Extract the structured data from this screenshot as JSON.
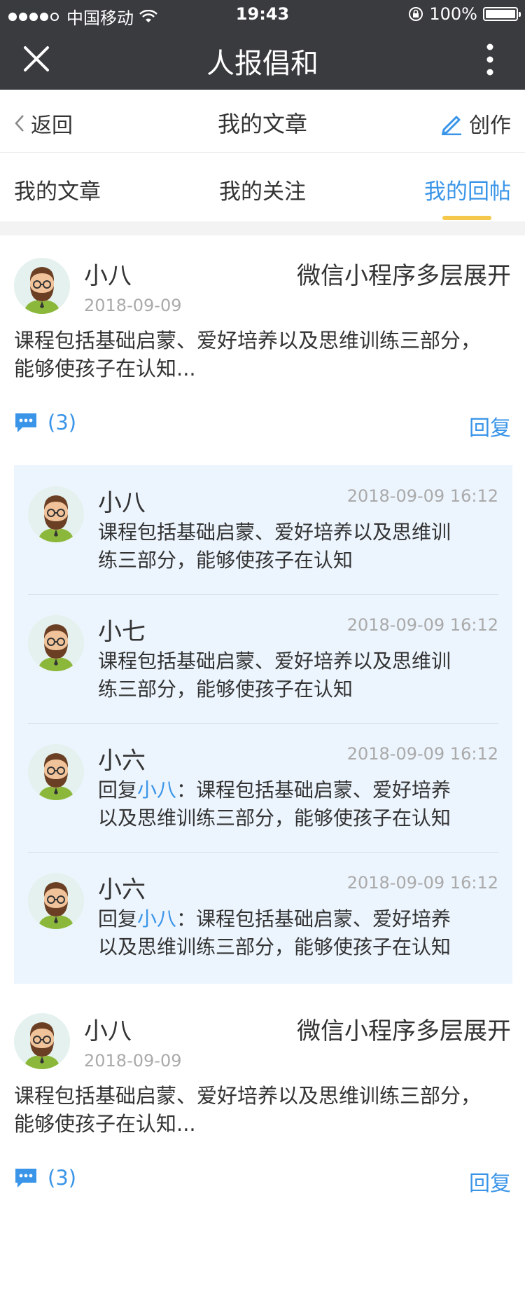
{
  "status_bar": {
    "carrier": "中国移动",
    "time": "19:43",
    "battery": "100%"
  },
  "title_bar": {
    "title": "人报倡和"
  },
  "nav": {
    "back_label": "返回",
    "page_title": "我的文章",
    "create_label": "创作"
  },
  "tabs": [
    {
      "label": "我的文章",
      "active": false
    },
    {
      "label": "我的关注",
      "active": false
    },
    {
      "label": "我的回帖",
      "active": true
    }
  ],
  "posts": [
    {
      "author": "小八",
      "title": "微信小程序多层展开",
      "date": "2018-09-09",
      "body_line1": "课程包括基础启蒙、爱好培养以及思维训练三部分，",
      "body_line2": "能够使孩子在认知...",
      "comment_count": "(3)",
      "reply_label": "回复"
    },
    {
      "author": "小八",
      "title": "微信小程序多层展开",
      "date": "2018-09-09",
      "body_line1": "课程包括基础启蒙、爱好培养以及思维训练三部分，",
      "body_line2": "能够使孩子在认知...",
      "comment_count": "(3)",
      "reply_label": "回复"
    }
  ],
  "replies": [
    {
      "author": "小八",
      "time": "2018-09-09 16:12",
      "prefix": "",
      "mention": "",
      "line1": "课程包括基础启蒙、爱好培养以及思维训",
      "line2": "练三部分，能够使孩子在认知"
    },
    {
      "author": "小七",
      "time": "2018-09-09 16:12",
      "prefix": "",
      "mention": "",
      "line1": "课程包括基础启蒙、爱好培养以及思维训",
      "line2": "练三部分，能够使孩子在认知"
    },
    {
      "author": "小六",
      "time": "2018-09-09 16:12",
      "prefix": "回复",
      "mention": "小八",
      "line1": "：课程包括基础启蒙、爱好培养",
      "line2": "以及思维训练三部分，能够使孩子在认知"
    },
    {
      "author": "小六",
      "time": "2018-09-09 16:12",
      "prefix": "回复",
      "mention": "小八",
      "line1": "：课程包括基础启蒙、爱好培养",
      "line2": "以及思维训练三部分，能够使孩子在认知"
    }
  ],
  "colors": {
    "accent": "#3a95e8",
    "header_bg": "#3a3b3f",
    "tab_indicator": "#f5c74a",
    "reply_bg": "#ecf4fd"
  }
}
